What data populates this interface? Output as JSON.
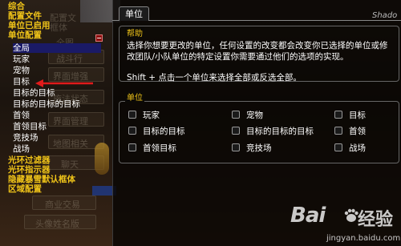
{
  "tree": {
    "categories_top": [
      "综合",
      "配置文件",
      "单位已启用",
      "单位配置"
    ],
    "units": [
      "全局",
      "玩家",
      "宠物",
      "目标",
      "目标的目标",
      "目标的目标的目标",
      "首领",
      "首领目标",
      "竞技场",
      "战场"
    ],
    "categories_bottom": [
      "光环过滤器",
      "光环指示器",
      "隐藏暴雪默认框体",
      "区域配置"
    ],
    "selected": "目标",
    "collapse_symbol": "−"
  },
  "background_labels": [
    "配置文",
    "框体",
    "全图",
    "战斗行",
    "界面增强",
    "施法状态",
    "界面管理",
    "地图相关",
    "聊天",
    "商业交易",
    "头像姓名版"
  ],
  "panel": {
    "tab": "单位",
    "corner_text": "Shado",
    "help": {
      "title": "帮助",
      "text": "选择你想要更改的单位，任何设置的改变都会改变你已选择的单位或修改团队/小队单位的特定设置你需要通过他们的选项的实现。",
      "shift_hint": "Shift + 点击一个单位来选择全部或反选全部。"
    },
    "units_box": {
      "title": "单位",
      "options": [
        {
          "label": "玩家"
        },
        {
          "label": "宠物"
        },
        {
          "label": "目标"
        },
        {
          "label": "目标的目标"
        },
        {
          "label": "目标的目标的目标"
        },
        {
          "label": "首领"
        },
        {
          "label": "首领目标"
        },
        {
          "label": "竞技场"
        },
        {
          "label": "战场"
        }
      ]
    }
  },
  "watermark": {
    "logo": "Bai",
    "suffix": "经验",
    "url": "jingyan.baidu.com"
  },
  "colors": {
    "category": "#f0c419",
    "selected_bg": "#1a1a66",
    "arrow": "#e01b1b"
  }
}
